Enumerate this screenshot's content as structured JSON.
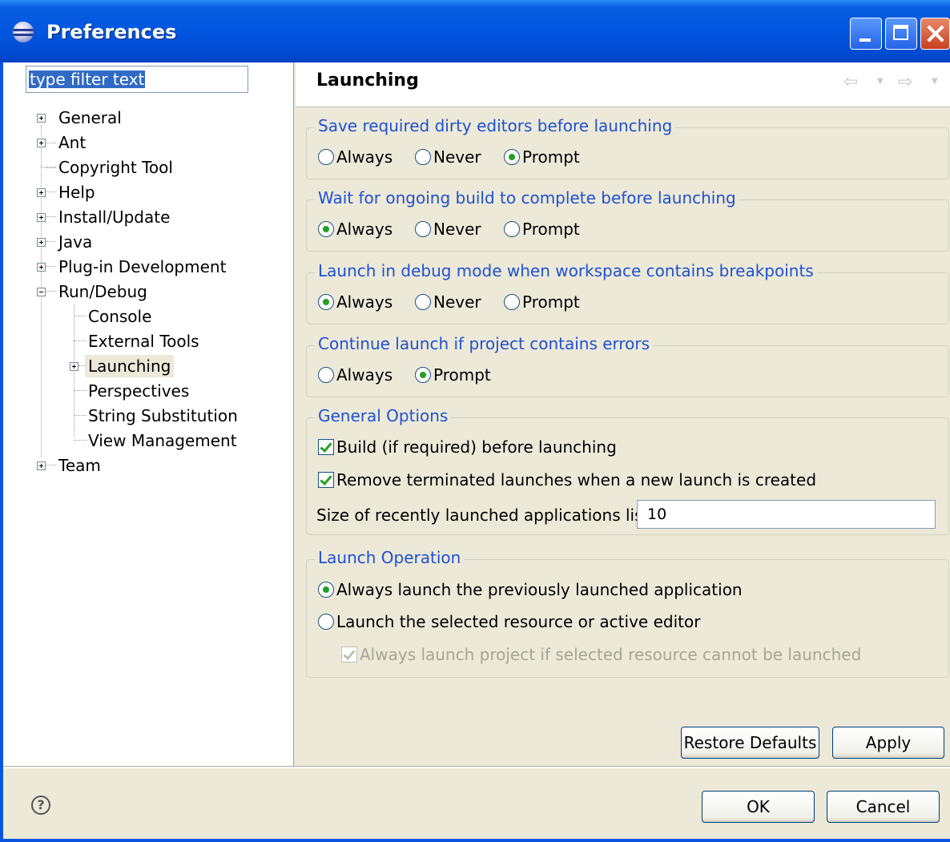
{
  "window": {
    "title": "Preferences"
  },
  "filter": {
    "text": "type filter text"
  },
  "tree": [
    {
      "label": "General"
    },
    {
      "label": "Ant"
    },
    {
      "label": "Copyright Tool"
    },
    {
      "label": "Help"
    },
    {
      "label": "Install/Update"
    },
    {
      "label": "Java"
    },
    {
      "label": "Plug-in Development"
    },
    {
      "label": "Run/Debug"
    },
    {
      "label": "Console"
    },
    {
      "label": "External Tools"
    },
    {
      "label": "Launching"
    },
    {
      "label": "Perspectives"
    },
    {
      "label": "String Substitution"
    },
    {
      "label": "View Management"
    },
    {
      "label": "Team"
    }
  ],
  "page": {
    "title": "Launching",
    "groups": {
      "save": {
        "label": "Save required dirty editors before launching",
        "options": [
          "Always",
          "Never",
          "Prompt"
        ],
        "selected": "Prompt"
      },
      "wait": {
        "label": "Wait for ongoing build to complete before launching",
        "options": [
          "Always",
          "Never",
          "Prompt"
        ],
        "selected": "Always"
      },
      "debug": {
        "label": "Launch in debug mode when workspace contains breakpoints",
        "options": [
          "Always",
          "Never",
          "Prompt"
        ],
        "selected": "Always"
      },
      "errors": {
        "label": "Continue launch if project contains errors",
        "options": [
          "Always",
          "Prompt"
        ],
        "selected": "Prompt"
      },
      "general": {
        "label": "General Options",
        "build": "Build (if required) before launching",
        "remove": "Remove terminated launches when a new launch is created",
        "size_label": "Size of recently launched applications list:",
        "size_value": "10"
      },
      "operation": {
        "label": "Launch Operation",
        "previous": "Always launch the previously launched application",
        "selected": "Launch the selected resource or active editor",
        "project": "Always launch project if selected resource cannot be launched"
      }
    }
  },
  "buttons": {
    "restore": "Restore Defaults",
    "apply": "Apply",
    "ok": "OK",
    "cancel": "Cancel"
  }
}
